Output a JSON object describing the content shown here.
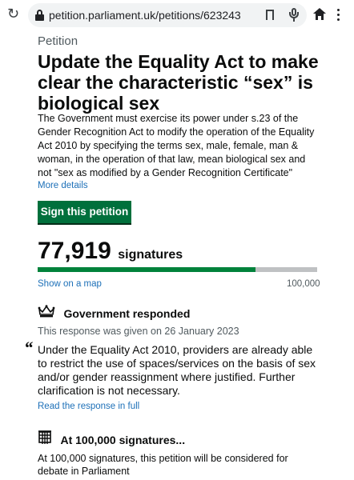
{
  "browser": {
    "url": "petition.parliament.uk/petitions/623243"
  },
  "petition": {
    "caption": "Petition",
    "title": "Update the Equality Act to make clear the characteristic “sex” is biological sex",
    "summary": "The Government must exercise its power under s.23 of the Gender Recognition Act to modify the operation of the Equality Act 2010 by specifying the terms sex, male, female, man & woman, in the operation of that law, mean biological sex and not \"sex as modified by a Gender Recognition Certificate\"",
    "more_details": "More details",
    "sign_label": "Sign this petition"
  },
  "signatures": {
    "count": "77,919",
    "label": "signatures",
    "show_map": "Show on a map",
    "goal_label": "100,000",
    "progress_fraction": 0.779
  },
  "government": {
    "heading": "Government responded",
    "date_text": "This response was given on 26 January 2023",
    "quote_mark": "“",
    "response": "Under the Equality Act 2010, providers are already able to restrict the use of spaces/services on the basis of sex and/or gender reassignment where justified. Further clarification is not necessary.",
    "read_full": "Read the response in full"
  },
  "debate": {
    "heading": "At 100,000 signatures...",
    "text": "At 100,000 signatures, this petition will be considered for debate in Parliament"
  },
  "icons": {
    "reload": "reload-icon",
    "lock": "lock-icon",
    "bookmark": "bookmark-icon",
    "mic": "microphone-icon",
    "home": "home-icon",
    "menu": "kebab-menu-icon",
    "crown": "crown-icon",
    "portcullis": "portcullis-icon"
  },
  "colors": {
    "button_green": "#00703c",
    "progress_green": "#00823b",
    "link_blue": "#1d70b8"
  }
}
